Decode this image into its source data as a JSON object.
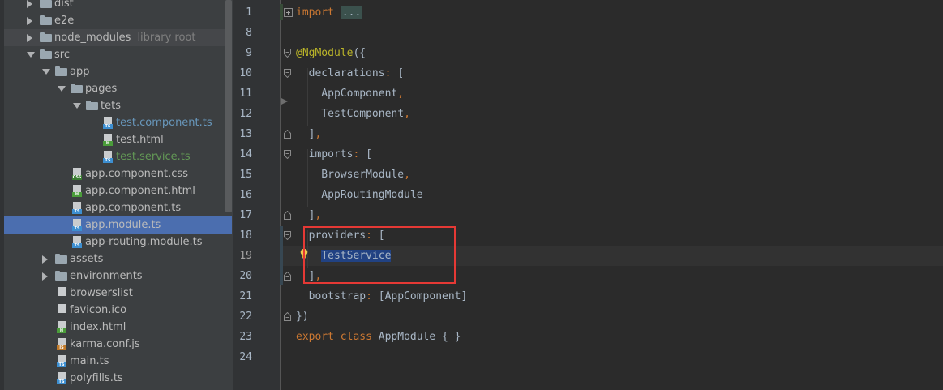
{
  "project_tree": {
    "items": [
      {
        "label": "dist",
        "kind": "folder",
        "expanded": false,
        "depth": 1
      },
      {
        "label": "e2e",
        "kind": "folder",
        "expanded": false,
        "depth": 1
      },
      {
        "label": "node_modules",
        "hint": "library root",
        "kind": "folder",
        "expanded": false,
        "depth": 1
      },
      {
        "label": "src",
        "kind": "folder",
        "expanded": true,
        "depth": 1
      },
      {
        "label": "app",
        "kind": "folder",
        "expanded": true,
        "depth": 2
      },
      {
        "label": "pages",
        "kind": "folder",
        "expanded": true,
        "depth": 3
      },
      {
        "label": "tets",
        "kind": "folder",
        "expanded": true,
        "depth": 4
      },
      {
        "label": "test.component.ts",
        "kind": "file",
        "badge": "TS",
        "color": "blue",
        "depth": 5
      },
      {
        "label": "test.html",
        "kind": "file",
        "badge": "H",
        "color": "default",
        "depth": 5
      },
      {
        "label": "test.service.ts",
        "kind": "file",
        "badge": "TS",
        "color": "green",
        "depth": 5
      },
      {
        "label": "app.component.css",
        "kind": "file",
        "badge": "CSS",
        "color": "default",
        "depth": 3
      },
      {
        "label": "app.component.html",
        "kind": "file",
        "badge": "H",
        "color": "default",
        "depth": 3
      },
      {
        "label": "app.component.ts",
        "kind": "file",
        "badge": "TS",
        "color": "default",
        "depth": 3
      },
      {
        "label": "app.module.ts",
        "kind": "file",
        "badge": "TS",
        "color": "default",
        "depth": 3,
        "selected": true
      },
      {
        "label": "app-routing.module.ts",
        "kind": "file",
        "badge": "TS",
        "color": "default",
        "depth": 3
      },
      {
        "label": "assets",
        "kind": "folder",
        "expanded": false,
        "depth": 2
      },
      {
        "label": "environments",
        "kind": "folder",
        "expanded": false,
        "depth": 2
      },
      {
        "label": "browserslist",
        "kind": "file",
        "badge": "",
        "color": "default",
        "depth": 2
      },
      {
        "label": "favicon.ico",
        "kind": "file",
        "badge": "",
        "color": "default",
        "depth": 2
      },
      {
        "label": "index.html",
        "kind": "file",
        "badge": "H",
        "color": "default",
        "depth": 2
      },
      {
        "label": "karma.conf.js",
        "kind": "file",
        "badge": "JS",
        "color": "default",
        "depth": 2
      },
      {
        "label": "main.ts",
        "kind": "file",
        "badge": "TS",
        "color": "default",
        "depth": 2
      },
      {
        "label": "polyfills.ts",
        "kind": "file",
        "badge": "TS",
        "color": "default",
        "depth": 2
      }
    ]
  },
  "editor": {
    "lines": [
      {
        "num": "1",
        "parts": [
          [
            "kw",
            "import"
          ],
          [
            "plain",
            " "
          ],
          [
            "dots",
            "..."
          ]
        ]
      },
      {
        "num": "8",
        "parts": []
      },
      {
        "num": "9",
        "parts": [
          [
            "ann",
            "@NgModule"
          ],
          [
            "plain",
            "({"
          ]
        ]
      },
      {
        "num": "10",
        "parts": [
          [
            "plain",
            "  declarations"
          ],
          [
            "punct",
            ":"
          ],
          [
            "plain",
            " ["
          ]
        ]
      },
      {
        "num": "11",
        "parts": [
          [
            "plain",
            "    AppComponent"
          ],
          [
            "punct",
            ","
          ]
        ]
      },
      {
        "num": "12",
        "parts": [
          [
            "plain",
            "    TestComponent"
          ],
          [
            "punct",
            ","
          ]
        ]
      },
      {
        "num": "13",
        "parts": [
          [
            "plain",
            "  ]"
          ],
          [
            "punct",
            ","
          ]
        ]
      },
      {
        "num": "14",
        "parts": [
          [
            "plain",
            "  imports"
          ],
          [
            "punct",
            ":"
          ],
          [
            "plain",
            " ["
          ]
        ]
      },
      {
        "num": "15",
        "parts": [
          [
            "plain",
            "    BrowserModule"
          ],
          [
            "punct",
            ","
          ]
        ]
      },
      {
        "num": "16",
        "parts": [
          [
            "plain",
            "    AppRoutingModule"
          ]
        ]
      },
      {
        "num": "17",
        "parts": [
          [
            "plain",
            "  ]"
          ],
          [
            "punct",
            ","
          ]
        ]
      },
      {
        "num": "18",
        "parts": [
          [
            "plain",
            "  providers"
          ],
          [
            "punct",
            ":"
          ],
          [
            "plain",
            " ["
          ]
        ]
      },
      {
        "num": "19",
        "parts": [
          [
            "plain",
            "    "
          ],
          [
            "sel",
            "TestService"
          ]
        ]
      },
      {
        "num": "20",
        "parts": [
          [
            "plain",
            "  ]"
          ],
          [
            "punct",
            ","
          ]
        ]
      },
      {
        "num": "21",
        "parts": [
          [
            "plain",
            "  bootstrap"
          ],
          [
            "punct",
            ":"
          ],
          [
            "plain",
            " [AppComponent]"
          ]
        ]
      },
      {
        "num": "22",
        "parts": [
          [
            "plain",
            "})"
          ]
        ]
      },
      {
        "num": "23",
        "parts": [
          [
            "kw",
            "export"
          ],
          [
            "plain",
            " "
          ],
          [
            "kw",
            "class"
          ],
          [
            "plain",
            " AppModule { }"
          ]
        ]
      },
      {
        "num": "24",
        "parts": []
      }
    ],
    "current_line": "19"
  },
  "colors": {
    "keyword": "#cc7832",
    "annotation": "#bbb529",
    "text": "#a9b7c6",
    "selection": "#214283",
    "highlight_box": "#e53935"
  }
}
